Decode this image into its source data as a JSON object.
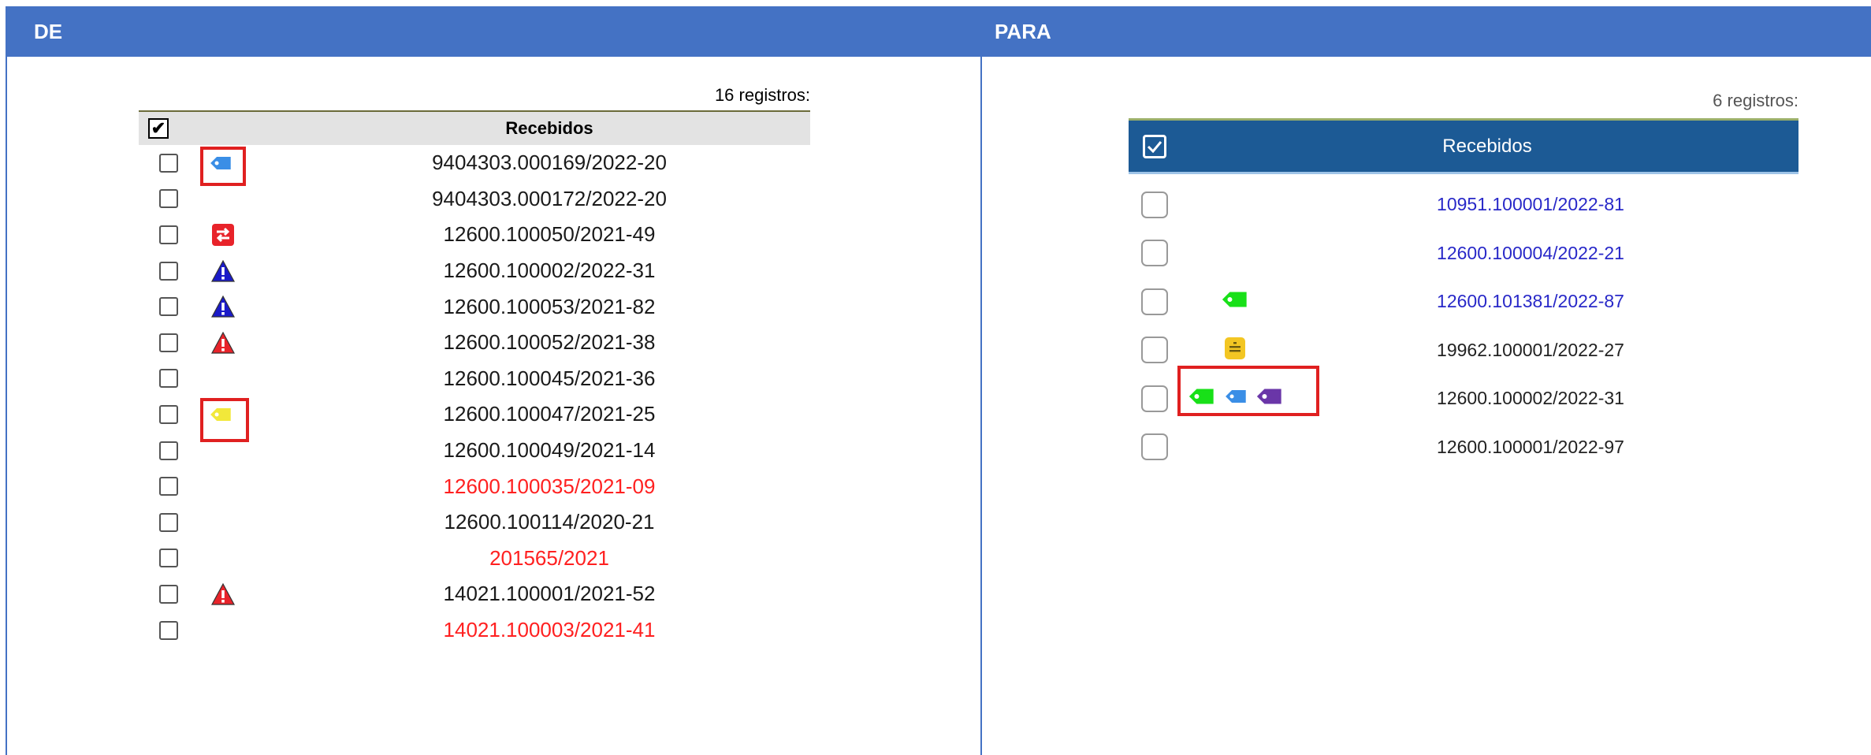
{
  "de": {
    "header": "DE",
    "count": "16 registros:",
    "column_title": "Recebidos",
    "rows": [
      {
        "number": "9404303.000169/2022-20",
        "icon": "blue-tag-icon",
        "color": "#1a1a1a"
      },
      {
        "number": "9404303.000172/2022-20",
        "icon": "",
        "color": "#1a1a1a"
      },
      {
        "number": "12600.100050/2021-49",
        "icon": "red-transfer-icon",
        "color": "#1a1a1a"
      },
      {
        "number": "12600.100002/2022-31",
        "icon": "blue-warning-icon",
        "color": "#1a1a1a"
      },
      {
        "number": "12600.100053/2021-82",
        "icon": "blue-warning-icon",
        "color": "#1a1a1a"
      },
      {
        "number": "12600.100052/2021-38",
        "icon": "red-warning-icon",
        "color": "#1a1a1a"
      },
      {
        "number": "12600.100045/2021-36",
        "icon": "",
        "color": "#1a1a1a"
      },
      {
        "number": "12600.100047/2021-25",
        "icon": "yellow-tag-icon",
        "color": "#1a1a1a"
      },
      {
        "number": "12600.100049/2021-14",
        "icon": "",
        "color": "#1a1a1a"
      },
      {
        "number": "12600.100035/2021-09",
        "icon": "",
        "color": "#ff2020"
      },
      {
        "number": "12600.100114/2020-21",
        "icon": "",
        "color": "#1a1a1a"
      },
      {
        "number": "201565/2021",
        "icon": "",
        "color": "#ff2020"
      },
      {
        "number": "14021.100001/2021-52",
        "icon": "red-warning-icon",
        "color": "#1a1a1a"
      },
      {
        "number": "14021.100003/2021-41",
        "icon": "",
        "color": "#ff2020"
      }
    ]
  },
  "para": {
    "header": "PARA",
    "count": "6 registros:",
    "column_title": "Recebidos",
    "rows": [
      {
        "number": "10951.100001/2022-81",
        "icons": [],
        "color": "#2828c8"
      },
      {
        "number": "12600.100004/2022-21",
        "icons": [],
        "color": "#2828c8"
      },
      {
        "number": "12600.101381/2022-87",
        "icons": [
          "green-tag-icon"
        ],
        "color": "#2828c8"
      },
      {
        "number": "19962.100001/2022-27",
        "icons": [
          "yellow-note-icon"
        ],
        "color": "#222222"
      },
      {
        "number": "12600.100002/2022-31",
        "icons": [
          "green-tag-icon",
          "blue-tag-icon",
          "purple-tag-icon"
        ],
        "color": "#222222"
      },
      {
        "number": "12600.100001/2022-97",
        "icons": [],
        "color": "#222222"
      }
    ]
  },
  "colors": {
    "header_bg": "#4472c4",
    "para_table_header": "#1c5a95",
    "highlight_box": "#e02020"
  }
}
